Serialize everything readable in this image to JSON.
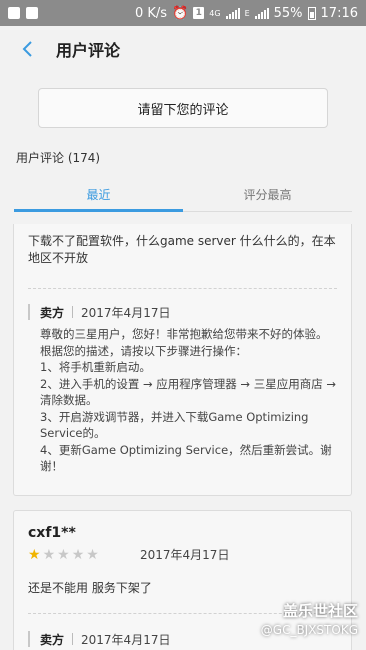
{
  "status_bar": {
    "speed": "0 K/s",
    "sim_badge": "1",
    "network": "4G",
    "network_sub": "E",
    "battery": "55%",
    "time": "17:16"
  },
  "header": {
    "title": "用户评论"
  },
  "actions": {
    "leave_review": "请留下您的评论"
  },
  "reviews_header": {
    "count_label": "用户评论 (174)"
  },
  "tabs": [
    {
      "label": "最近",
      "active": true
    },
    {
      "label": "评分最高",
      "active": false
    }
  ],
  "reviews": [
    {
      "text": "下载不了配置软件，什么game server 什么什么的，在本地区不开放",
      "reply": {
        "author": "卖方",
        "date": "2017年4月17日",
        "text": "尊敬的三星用户，您好！非常抱歉给您带来不好的体验。\n根据您的描述，请按以下步骤进行操作：\n1、将手机重新启动。\n2、进入手机的设置 → 应用程序管理器 → 三星应用商店 → 清除数据。\n3、开启游戏调节器，并进入下载Game Optimizing Service的。\n4、更新Game Optimizing Service，然后重新尝试。谢谢！"
      }
    },
    {
      "author": "cxf1**",
      "rating": 1,
      "max_rating": 5,
      "date": "2017年4月17日",
      "text": "还是不能用   服务下架了",
      "reply": {
        "author": "卖方",
        "date": "2017年4月17日"
      }
    }
  ],
  "watermark": {
    "logo": "盖乐世社区",
    "handle": "@GC_BJXSTOKG"
  },
  "colors": {
    "accent": "#3b9be0",
    "star_on": "#f0b400",
    "star_off": "#c8c8c8",
    "status_bar": "#8b8b8b"
  }
}
